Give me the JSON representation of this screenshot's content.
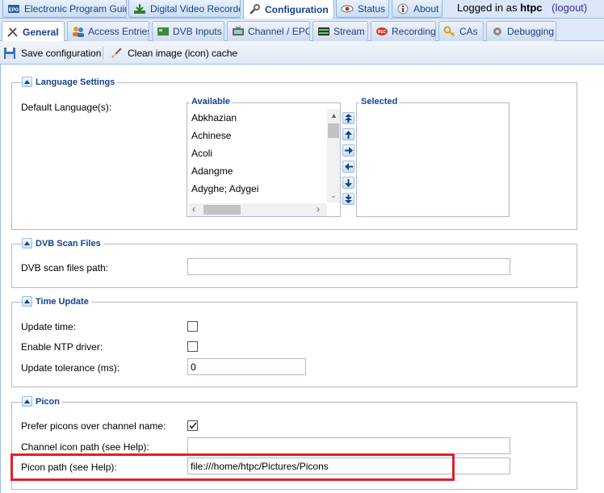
{
  "top_tabs": [
    {
      "label": "Electronic Program Guide",
      "icon": "epg-icon"
    },
    {
      "label": "Digital Video Recorder",
      "icon": "download-icon"
    },
    {
      "label": "Configuration",
      "icon": "wrench-icon",
      "active": true
    },
    {
      "label": "Status",
      "icon": "eye-icon"
    },
    {
      "label": "About",
      "icon": "info-icon"
    }
  ],
  "login": {
    "prefix": "Logged in as",
    "user": "htpc",
    "logout": "(logout)"
  },
  "sub_tabs": [
    {
      "label": "General",
      "icon": "tools-icon",
      "active": true
    },
    {
      "label": "Access Entries",
      "icon": "users-icon"
    },
    {
      "label": "DVB Inputs",
      "icon": "card-icon"
    },
    {
      "label": "Channel / EPG",
      "icon": "tv-icon"
    },
    {
      "label": "Stream",
      "icon": "stream-icon"
    },
    {
      "label": "Recording",
      "icon": "rec-icon"
    },
    {
      "label": "CAs",
      "icon": "key-icon"
    },
    {
      "label": "Debugging",
      "icon": "debug-icon"
    }
  ],
  "toolbar": {
    "save_label": "Save configuration",
    "clean_label": "Clean image (icon) cache"
  },
  "language": {
    "legend": "Language Settings",
    "default_label": "Default Language(s):",
    "available_title": "Available",
    "selected_title": "Selected",
    "available": [
      "Abkhazian",
      "Achinese",
      "Acoli",
      "Adangme",
      "Adyghe; Adygei"
    ]
  },
  "dvb": {
    "legend": "DVB Scan Files",
    "path_label": "DVB scan files path:",
    "path_value": ""
  },
  "time": {
    "legend": "Time Update",
    "update_label": "Update time:",
    "ntp_label": "Enable NTP driver:",
    "tolerance_label": "Update tolerance (ms):",
    "tolerance_value": "0",
    "update_checked": false,
    "ntp_checked": false
  },
  "picon": {
    "legend": "Picon",
    "prefer_label": "Prefer picons over channel name:",
    "prefer_checked": true,
    "channel_icon_label": "Channel icon path (see Help):",
    "channel_icon_value": "",
    "path_label": "Picon path (see Help):",
    "path_value": "file:///home/htpc/Pictures/Picons"
  },
  "colors": {
    "accent": "#15428b",
    "highlight": "#e0202a",
    "tab_border": "#99bbe8"
  }
}
